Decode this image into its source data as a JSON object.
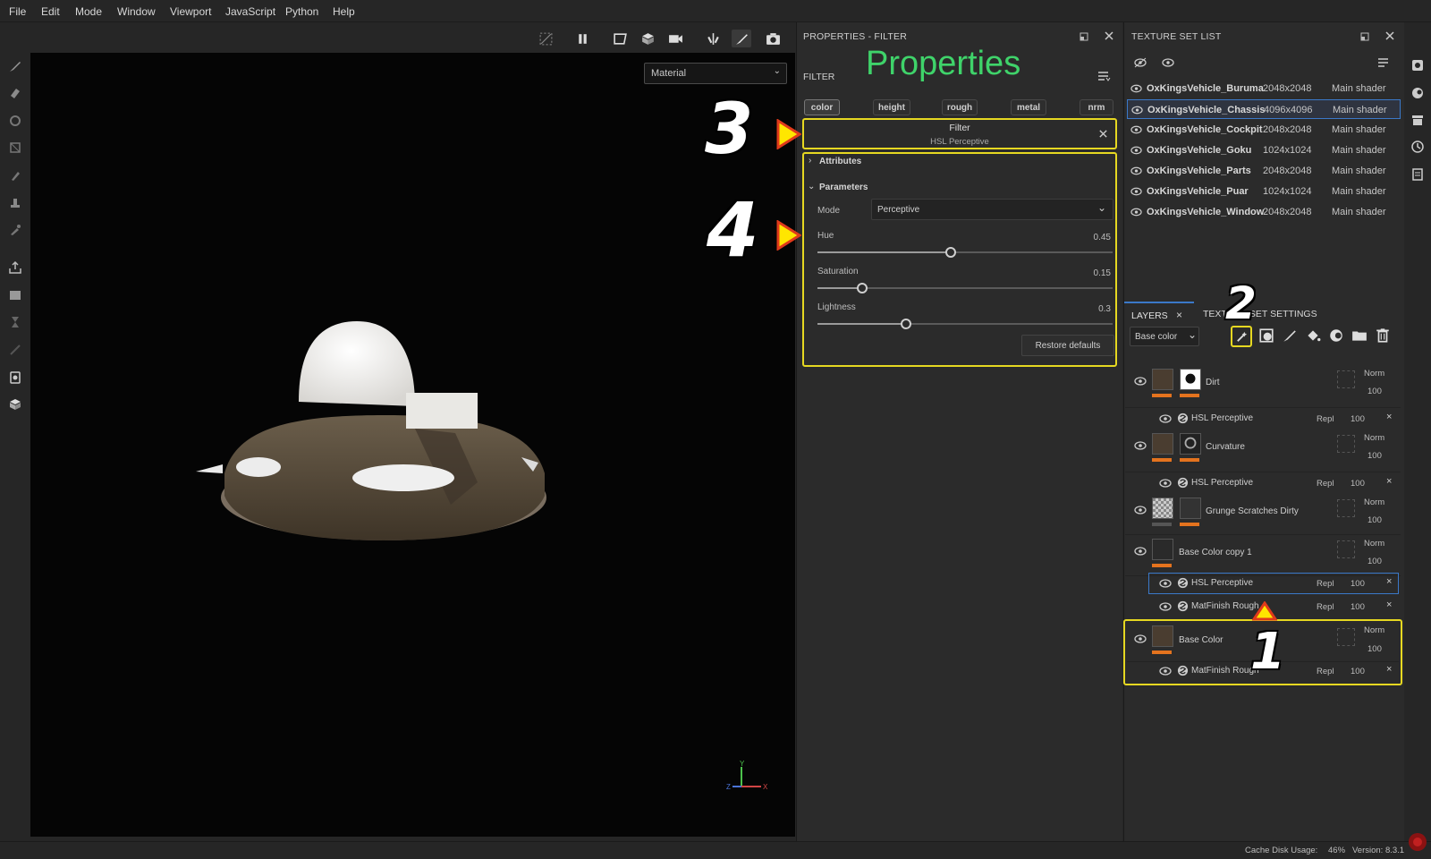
{
  "menu": [
    "File",
    "Edit",
    "Mode",
    "Window",
    "Viewport",
    "JavaScript",
    "Python",
    "Help"
  ],
  "viewport": {
    "material_select": "Material",
    "axis": {
      "x": "X",
      "y": "Y",
      "z": "Z"
    }
  },
  "properties": {
    "title": "PROPERTIES - FILTER",
    "section": "FILTER",
    "annotation": "Properties",
    "channels": [
      "color",
      "height",
      "rough",
      "metal",
      "nrm"
    ],
    "filter_label": "Filter",
    "filter_name": "HSL Perceptive",
    "attributes": "Attributes",
    "parameters": "Parameters",
    "mode_label": "Mode",
    "mode_value": "Perceptive",
    "hue_label": "Hue",
    "hue_value": "0.45",
    "hue": 0.45,
    "sat_label": "Saturation",
    "sat_value": "0.15",
    "sat": 0.15,
    "light_label": "Lightness",
    "light_value": "0.3",
    "light": 0.3,
    "restore": "Restore defaults"
  },
  "texture_sets": {
    "title": "TEXTURE SET LIST",
    "rows": [
      {
        "name": "OxKingsVehicle_Buruma",
        "res": "2048x2048",
        "shader": "Main shader"
      },
      {
        "name": "OxKingsVehicle_Chassis",
        "res": "4096x4096",
        "shader": "Main shader"
      },
      {
        "name": "OxKingsVehicle_Cockpit",
        "res": "2048x2048",
        "shader": "Main shader"
      },
      {
        "name": "OxKingsVehicle_Goku",
        "res": "1024x1024",
        "shader": "Main shader"
      },
      {
        "name": "OxKingsVehicle_Parts",
        "res": "2048x2048",
        "shader": "Main shader"
      },
      {
        "name": "OxKingsVehicle_Puar",
        "res": "1024x1024",
        "shader": "Main shader"
      },
      {
        "name": "OxKingsVehicle_Window",
        "res": "2048x2048",
        "shader": "Main shader"
      }
    ]
  },
  "layers": {
    "tab1": "LAYERS",
    "tab2": "TEXTURE SET SETTINGS",
    "channel_select": "Base color",
    "items": [
      {
        "name": "Dirt",
        "blend": "Norm",
        "opacity": "100",
        "sub": {
          "name": "HSL Perceptive",
          "blend": "Repl",
          "opacity": "100"
        }
      },
      {
        "name": "Curvature",
        "blend": "Norm",
        "opacity": "100",
        "sub": {
          "name": "HSL Perceptive",
          "blend": "Repl",
          "opacity": "100"
        }
      },
      {
        "name": "Grunge Scratches Dirty",
        "blend": "Norm",
        "opacity": "100"
      },
      {
        "name": "Base Color copy 1",
        "blend": "Norm",
        "opacity": "100",
        "sub": {
          "name": "HSL Perceptive",
          "blend": "Repl",
          "opacity": "100"
        },
        "sub2": {
          "name": "MatFinish Rough",
          "blend": "Repl",
          "opacity": "100"
        }
      },
      {
        "name": "Base Color",
        "blend": "Norm",
        "opacity": "100",
        "sub": {
          "name": "MatFinish Rough",
          "blend": "Repl",
          "opacity": "100"
        }
      }
    ]
  },
  "annotations": {
    "n1": "1",
    "n2": "2",
    "n3": "3",
    "n4": "4"
  },
  "status": {
    "cache_label": "Cache Disk Usage:",
    "cache_value": "46%",
    "version": "Version: 8.3.1"
  },
  "colors": {
    "accent_yellow": "#e6d821",
    "accent_orange": "#e4731e",
    "green_label": "#3fd36a",
    "selection_blue": "#3b79c9"
  }
}
